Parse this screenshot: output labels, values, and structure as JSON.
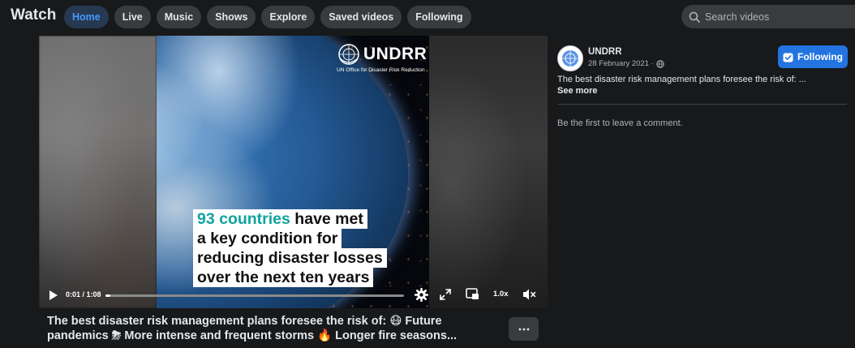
{
  "app": {
    "title": "Watch"
  },
  "nav": {
    "items": [
      {
        "label": "Home",
        "active": true
      },
      {
        "label": "Live"
      },
      {
        "label": "Music"
      },
      {
        "label": "Shows"
      },
      {
        "label": "Explore"
      },
      {
        "label": "Saved videos"
      },
      {
        "label": "Following"
      }
    ]
  },
  "search": {
    "placeholder": "Search videos",
    "icon": "search-icon"
  },
  "video": {
    "brand_name": "UNDRR",
    "brand_subtitle": "UN Office for Disaster Risk Reduction",
    "caption": {
      "line1_accent": "93 countries",
      "line1_rest": " have met",
      "line2": "a key condition for",
      "line3": "reducing disaster losses",
      "line4": "over the next ten years"
    },
    "controls": {
      "time": "0:01 / 1:08",
      "progress_fraction": 0.015,
      "speed": "1.0x",
      "icons": [
        "play-icon",
        "settings-icon",
        "fullscreen-icon",
        "picture-in-picture-icon",
        "mute-icon"
      ]
    }
  },
  "post": {
    "title": "The best disaster risk management plans foresee the risk of: 😷 Future pandemics ⛈ More intense and frequent storms 🔥 Longer fire seasons...",
    "more_label": "···",
    "page_name": "UNDRR",
    "date": "28 February 2021 ·",
    "follow_label": "Following",
    "text": "The best disaster risk management plans foresee the risk of: ...",
    "see_more": "See more",
    "comments_empty": "Be the first to leave a comment."
  },
  "colors": {
    "accent": "#2374e1",
    "active_nav_text": "#4599ff",
    "caption_accent": "#10a39e"
  }
}
